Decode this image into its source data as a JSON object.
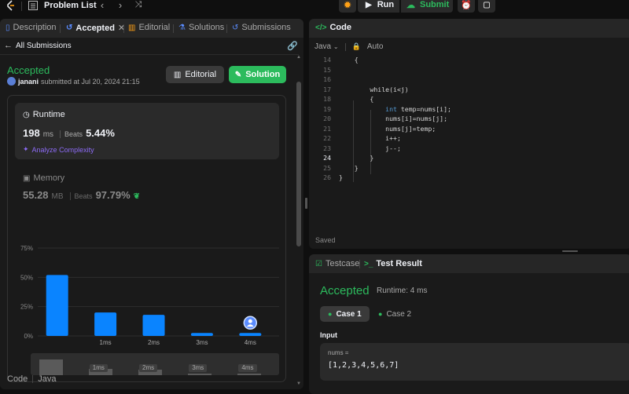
{
  "topbar": {
    "problem_list_label": "Problem List",
    "run_label": "Run",
    "submit_label": "Submit"
  },
  "left_tabs": [
    {
      "label": "Description",
      "icon": "description-icon"
    },
    {
      "label": "Accepted",
      "icon": "history-icon",
      "active": true
    },
    {
      "label": "Editorial",
      "icon": "book-icon"
    },
    {
      "label": "Solutions",
      "icon": "flask-icon"
    },
    {
      "label": "Submissions",
      "icon": "history-icon"
    }
  ],
  "submission": {
    "back_label": "All Submissions",
    "status": "Accepted",
    "user": "janani",
    "submitted_text": "submitted at Jul 20, 2024 21:15",
    "editorial_button": "Editorial",
    "solution_button": "Solution"
  },
  "runtime": {
    "title": "Runtime",
    "value": "198",
    "unit": "ms",
    "beats_label": "Beats",
    "beats_value": "5.44%",
    "analyze_label": "Analyze Complexity"
  },
  "memory": {
    "title": "Memory",
    "value": "55.28",
    "unit": "MB",
    "beats_label": "Beats",
    "beats_value": "97.79%"
  },
  "chart_data": {
    "type": "bar",
    "categories": [
      "",
      "1ms",
      "2ms",
      "3ms",
      "4ms"
    ],
    "values": [
      52,
      20,
      18,
      2.5,
      2.5
    ],
    "ylim": [
      0,
      75
    ],
    "yticks": [
      "0%",
      "25%",
      "50%",
      "75%"
    ],
    "color": "#0a84ff",
    "highlight_category": "4ms",
    "navigator_labels": [
      "1ms",
      "2ms",
      "3ms",
      "4ms"
    ]
  },
  "code_footer": {
    "label": "Code",
    "lang": "Java"
  },
  "code_panel": {
    "title": "Code",
    "language": "Java",
    "auto_label": "Auto",
    "saved_label": "Saved",
    "current_line": 24,
    "lines": [
      {
        "n": "14",
        "t": "    {"
      },
      {
        "n": "15",
        "t": ""
      },
      {
        "n": "16",
        "t": ""
      },
      {
        "n": "17",
        "t": "        while(i<j)"
      },
      {
        "n": "18",
        "t": "        {"
      },
      {
        "n": "19",
        "t": "            int temp=nums[i];"
      },
      {
        "n": "20",
        "t": "            nums[i]=nums[j];"
      },
      {
        "n": "21",
        "t": "            nums[j]=temp;"
      },
      {
        "n": "22",
        "t": "            i++;"
      },
      {
        "n": "23",
        "t": "            j--;"
      },
      {
        "n": "24",
        "t": "        }"
      },
      {
        "n": "25",
        "t": "    }"
      },
      {
        "n": "26",
        "t": "}"
      }
    ]
  },
  "result_panel": {
    "testcase_tab": "Testcase",
    "result_tab": "Test Result",
    "status": "Accepted",
    "runtime_text": "Runtime: 4 ms",
    "cases": [
      "Case 1",
      "Case 2"
    ],
    "input_label": "Input",
    "var_name": "nums =",
    "var_value": "[1,2,3,4,5,6,7]"
  },
  "colors": {
    "accent_green": "#2cbb5d",
    "accent_blue": "#0a84ff",
    "purple": "#8c6bf5",
    "submit_green": "#2cbb5d"
  }
}
